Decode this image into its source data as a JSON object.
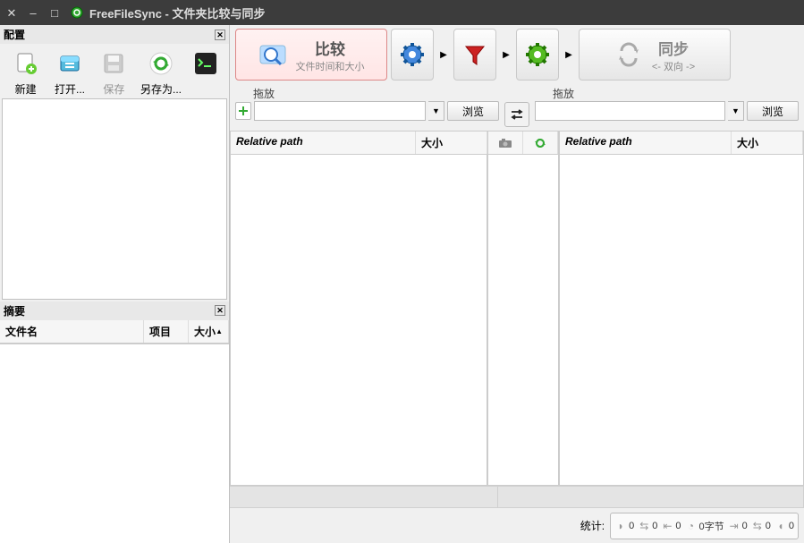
{
  "titlebar": {
    "title": "FreeFileSync - 文件夹比较与同步"
  },
  "sidebar": {
    "config_header": "配置",
    "summary_header": "摘要",
    "toolbar": {
      "new": "新建",
      "open": "打开...",
      "save": "保存",
      "saveas": "另存为..."
    },
    "summary_cols": {
      "filename": "文件名",
      "items": "项目",
      "size": "大小"
    }
  },
  "bigtoolbar": {
    "compare": {
      "label": "比较",
      "sub": "文件时间和大小"
    },
    "sync": {
      "label": "同步",
      "sub": "<- 双向 ->"
    }
  },
  "folder": {
    "drop_label": "拖放",
    "browse": "浏览",
    "left_value": "",
    "right_value": ""
  },
  "grid": {
    "relpath": "Relative path",
    "size": "大小"
  },
  "status": {
    "label": "统计:",
    "counts": [
      "0",
      "0",
      "0"
    ],
    "bytes": "0字节",
    "counts2": [
      "0",
      "0",
      "0"
    ]
  }
}
